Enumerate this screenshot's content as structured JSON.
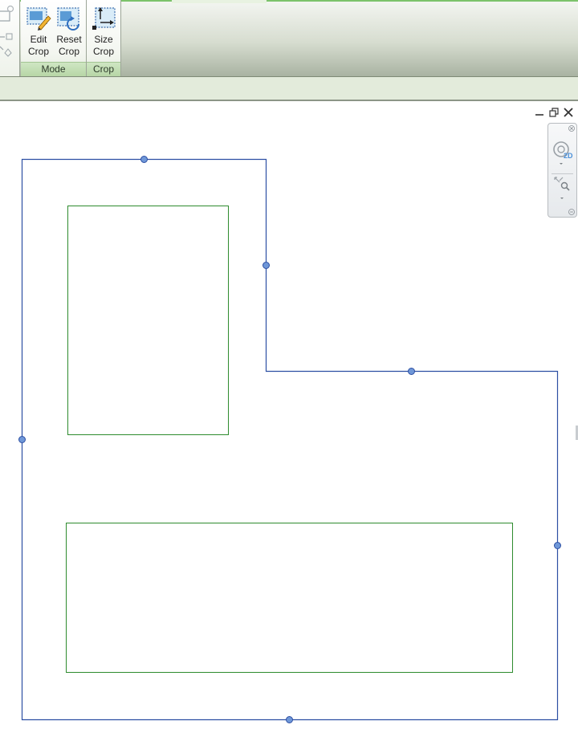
{
  "ribbon": {
    "mode_panel": {
      "label": "Mode",
      "buttons": [
        {
          "label": "Edit\nCrop",
          "icon": "edit-crop-icon"
        },
        {
          "label": "Reset\nCrop",
          "icon": "reset-crop-icon"
        }
      ]
    },
    "crop_panel": {
      "label": "Crop",
      "buttons": [
        {
          "label": "Size\nCrop",
          "icon": "size-crop-icon"
        }
      ]
    }
  },
  "window_controls": [
    "minimize-icon",
    "restore-icon",
    "close-icon"
  ],
  "navigation_bar": {
    "steering_wheel_badge": "2D",
    "tools": [
      "steering-wheel-2d-icon",
      "zoom-region-icon"
    ]
  },
  "colors": {
    "crop_boundary": "#2c4fa3",
    "handle_fill": "#6f97d8",
    "region_outline": "#2e8b2e",
    "ribbon_panel_label": "#b7d6a6"
  }
}
